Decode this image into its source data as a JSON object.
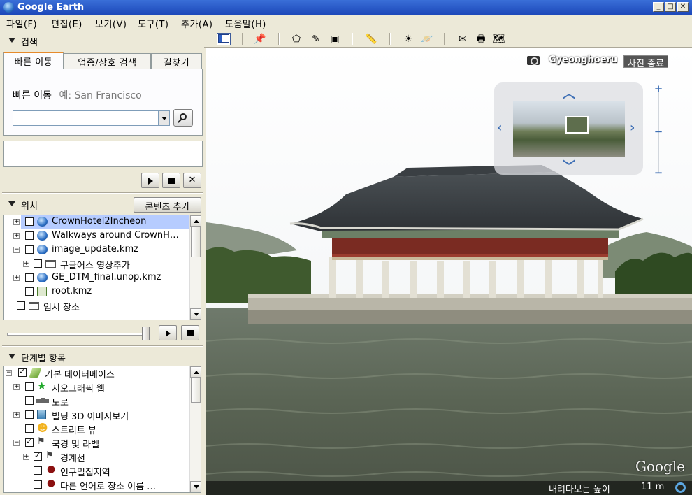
{
  "window": {
    "title": "Google Earth",
    "minimize": "_",
    "maximize": "□",
    "close": "✕"
  },
  "menu": [
    "파일(F)",
    "편집(E)",
    "보기(V)",
    "도구(T)",
    "추가(A)",
    "도움말(H)"
  ],
  "search": {
    "header": "검색",
    "tabs": [
      "빠른 이동",
      "업종/상호 검색",
      "길찾기"
    ],
    "hint_label": "빠른 이동",
    "hint_example": "예: San Francisco",
    "input_value": ""
  },
  "places": {
    "header": "위치",
    "add_content": "콘텐츠 추가",
    "items": [
      "CrownHotel2Incheon",
      "Walkways around CrownH…",
      "image_update.kmz",
      "구글어스 영상추가",
      "GE_DTM_final.unop.kmz",
      "root.kmz",
      "임시 장소"
    ]
  },
  "layers": {
    "header": "단계별 항목",
    "items": [
      "기본 데이터베이스",
      "지오그래픽 웹",
      "도로",
      "빌딩 3D 이미지보기",
      "스트리트 뷰",
      "국경 및 라벨",
      "경계선",
      "인구밀집지역",
      "다른 언어로 장소 이름 …"
    ]
  },
  "photo": {
    "name": "Gyeonghoeru",
    "exit_label": "사진 종료"
  },
  "viewport": {
    "logo": "Google",
    "altitude_label": "내려다보는 높이",
    "altitude_value": "11 m"
  },
  "colors": {
    "selection": "#b6ccff",
    "titlebar": "#1b46b8",
    "accent_tab": "#e68b2c"
  }
}
